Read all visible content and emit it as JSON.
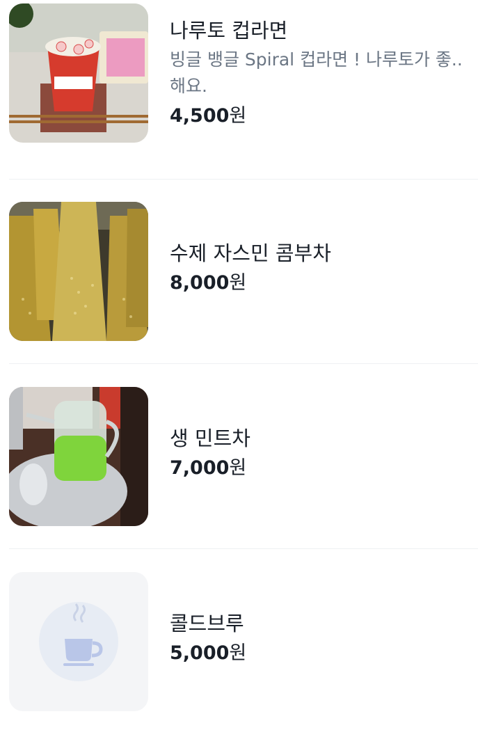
{
  "menu": {
    "items": [
      {
        "name": "나루토 컵라면",
        "description": "빙글 뱅글 Spiral 컵라면 ! 나루토가 좋..해요.",
        "price": "4,500",
        "currency": "원",
        "image": "cup-noodle-photo"
      },
      {
        "name": "수제 자스민 콤부차",
        "price": "8,000",
        "currency": "원",
        "image": "kombucha-bottles-photo"
      },
      {
        "name": "생 민트차",
        "price": "7,000",
        "currency": "원",
        "image": "mint-tea-pot-photo"
      },
      {
        "name": "콜드브루",
        "price": "5,000",
        "currency": "원",
        "image": "coffee-cup-icon"
      }
    ]
  },
  "colors": {
    "placeholder_bg": "#f4f5f7",
    "placeholder_circle": "#e7ecf4",
    "icon": "#b9c6e8"
  }
}
